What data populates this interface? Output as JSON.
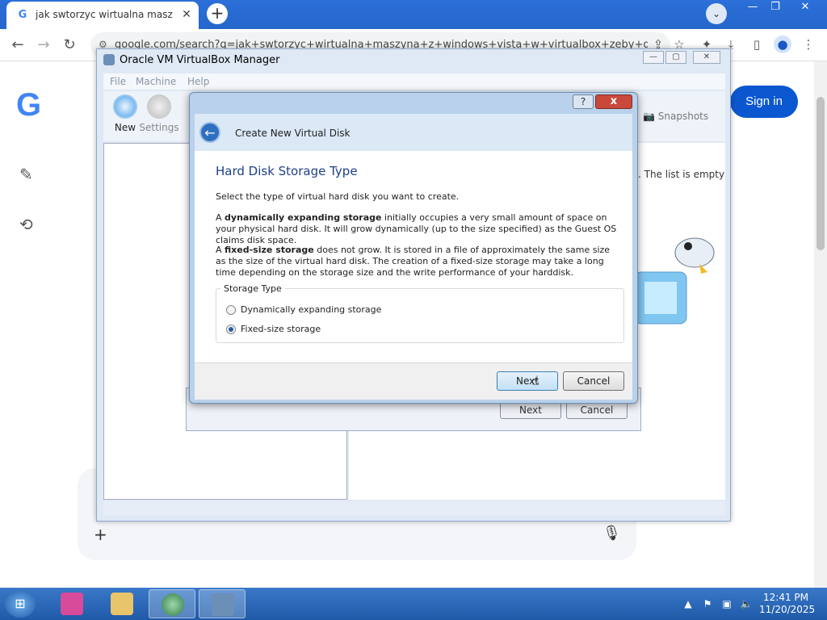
{
  "browser": {
    "tab_title": "jak swtorzyc wirtualna maszyna",
    "tab_favicon": "G",
    "url": "google.com/search?q=jak+swtorzyc+wirtualna+maszyna+z+windows+vista+w+virtualbox+zeby+dzialal...",
    "win_min": "—",
    "win_max": "❐",
    "win_close": "✕"
  },
  "google": {
    "logo": "G",
    "signin_label": "Sign in"
  },
  "vbox_manager": {
    "title": "Oracle VM VirtualBox Manager",
    "menu": [
      "File",
      "Machine",
      "Help"
    ],
    "tools": {
      "new": "New",
      "settings": "Settings"
    },
    "snapshots_label": "Snapshots",
    "empty_message": ". The list is empty"
  },
  "ghost_wizard": {
    "next": "Next",
    "cancel": "Cancel"
  },
  "dialog": {
    "title": "Create New Virtual Disk",
    "help": "?",
    "close": "x",
    "heading": "Hard Disk Storage Type",
    "intro": "Select the type of virtual hard disk you want to create.",
    "dynamic_lead": "A ",
    "dynamic_bold": "dynamically expanding storage",
    "dynamic_rest": " initially occupies a very small amount of space on your physical hard disk. It will grow dynamically (up to the size specified) as the Guest OS claims disk space.",
    "fixed_lead": "A ",
    "fixed_bold": "fixed-size storage",
    "fixed_rest": " does not grow. It is stored in a file of approximately the same size as the size of the virtual hard disk. The creation of a fixed-size storage may take a long time depending on the storage size and the write performance of your harddisk.",
    "group_label": "Storage Type",
    "options": [
      {
        "label": "Dynamically expanding storage",
        "selected": false
      },
      {
        "label": "Fixed-size storage",
        "selected": true
      }
    ],
    "next": "Next",
    "cancel": "Cancel"
  },
  "taskbar": {
    "time": "12:41 PM",
    "date": "11/20/2025"
  },
  "colors": {
    "chrome_blue": "#2566cc",
    "signin": "#0b57d0",
    "taskbar": "#1f5aa8",
    "dialog_heading": "#1e3f8a"
  }
}
